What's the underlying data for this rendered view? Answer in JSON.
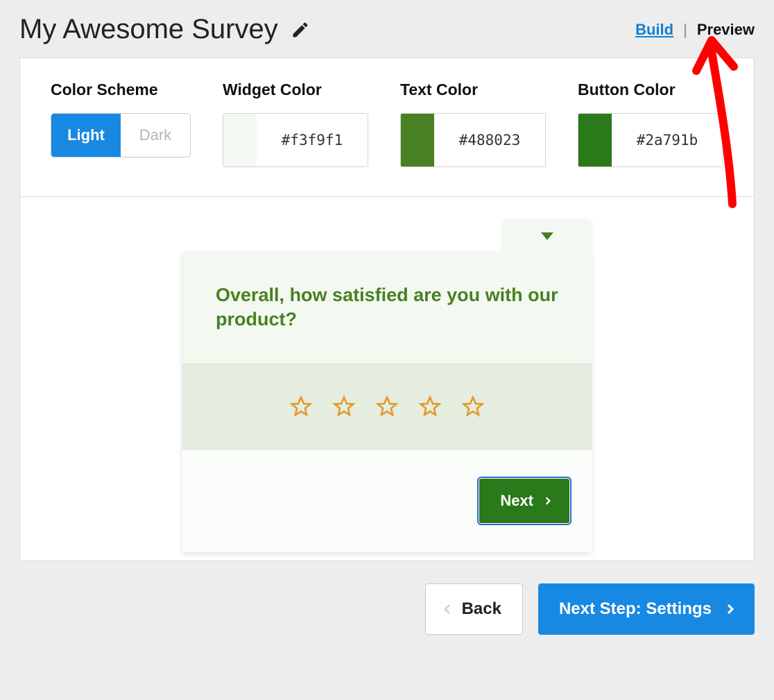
{
  "header": {
    "title": "My Awesome Survey",
    "tabs": {
      "build": "Build",
      "separator": "|",
      "preview": "Preview"
    }
  },
  "config": {
    "scheme": {
      "label": "Color Scheme",
      "light": "Light",
      "dark": "Dark",
      "active": "light"
    },
    "widget": {
      "label": "Widget Color",
      "hex": "#f3f9f1"
    },
    "text": {
      "label": "Text Color",
      "hex": "#488023"
    },
    "button": {
      "label": "Button Color",
      "hex": "#2a791b"
    }
  },
  "survey": {
    "question": "Overall, how satisfied are you with our product?",
    "next": "Next",
    "stars": 5
  },
  "nav": {
    "back": "Back",
    "next": "Next Step: Settings"
  }
}
